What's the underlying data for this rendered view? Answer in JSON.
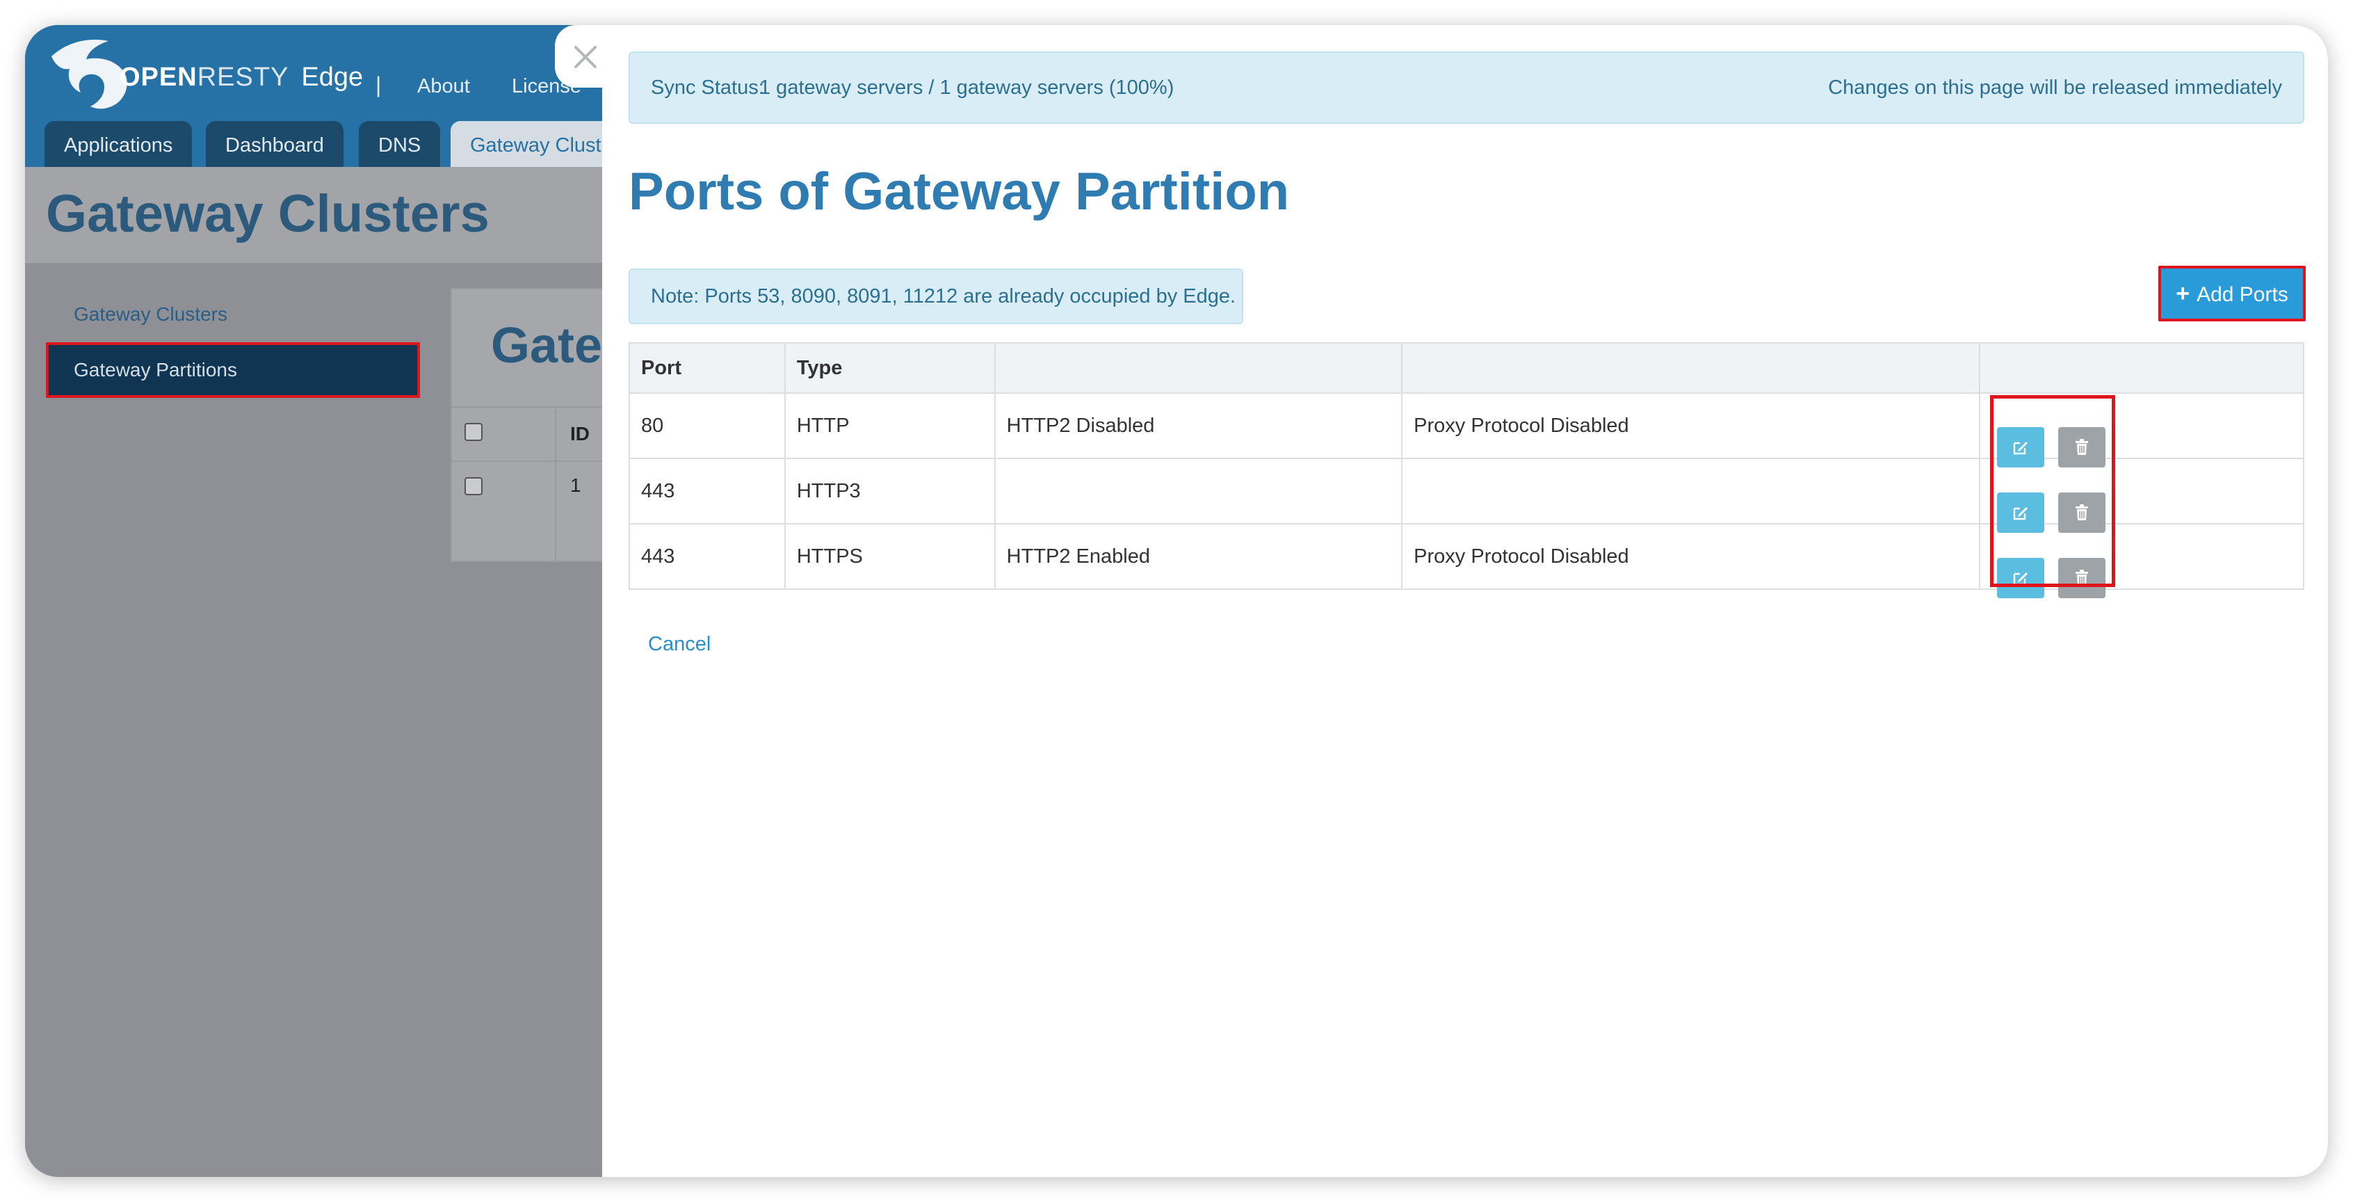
{
  "app": {
    "logo_word_bold": "OPEN",
    "logo_word_light": "RESTY",
    "product": "Edge",
    "separator": "|",
    "nav_links": [
      "About",
      "License"
    ],
    "tabs": [
      "Applications",
      "Dashboard",
      "DNS",
      "Gateway Clusters"
    ],
    "page_title": "Gateway Clusters",
    "sidebar": [
      "Gateway Clusters",
      "Gateway Partitions"
    ],
    "panel_title": "Gate",
    "panel_col_id": "ID",
    "panel_row_id": "1"
  },
  "drawer": {
    "sync_label": "Sync Status:",
    "sync_value": "1 gateway servers / 1 gateway servers (100%)",
    "sync_note": "Changes on this page will be released immediately",
    "title": "Ports of Gateway Partition",
    "note": "Note: Ports 53, 8090, 8091, 11212 are already occupied by Edge.",
    "add_button": "Add Ports",
    "cancel": "Cancel",
    "columns": [
      "Port",
      "Type",
      "",
      "",
      ""
    ],
    "rows": [
      {
        "port": "80",
        "type": "HTTP",
        "http2": "HTTP2 Disabled",
        "proxy": "Proxy Protocol Disabled"
      },
      {
        "port": "443",
        "type": "HTTP3",
        "http2": "",
        "proxy": ""
      },
      {
        "port": "443",
        "type": "HTTPS",
        "http2": "HTTP2 Enabled",
        "proxy": "Proxy Protocol Disabled"
      }
    ]
  },
  "colors": {
    "brand": "#2672a6",
    "title": "#2e7cb1",
    "info_bg": "#d9edf6",
    "primary_button": "#2a9bd9",
    "highlight": "#e0141c"
  },
  "icons": [
    "close-icon",
    "plus-icon",
    "edit-icon",
    "trash-icon",
    "openresty-bird-logo"
  ]
}
